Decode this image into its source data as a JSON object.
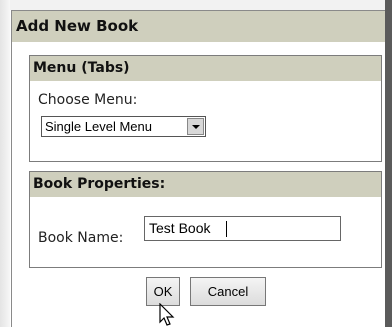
{
  "dialog": {
    "title": "Add New Book",
    "menu_section": {
      "header": "Menu (Tabs)",
      "label": "Choose Menu:",
      "selected_option": "Single Level Menu"
    },
    "book_section": {
      "header": "Book Properties:",
      "label": "Book Name:",
      "book_name_value": "Test Book"
    },
    "buttons": {
      "ok": "OK",
      "cancel": "Cancel"
    }
  }
}
